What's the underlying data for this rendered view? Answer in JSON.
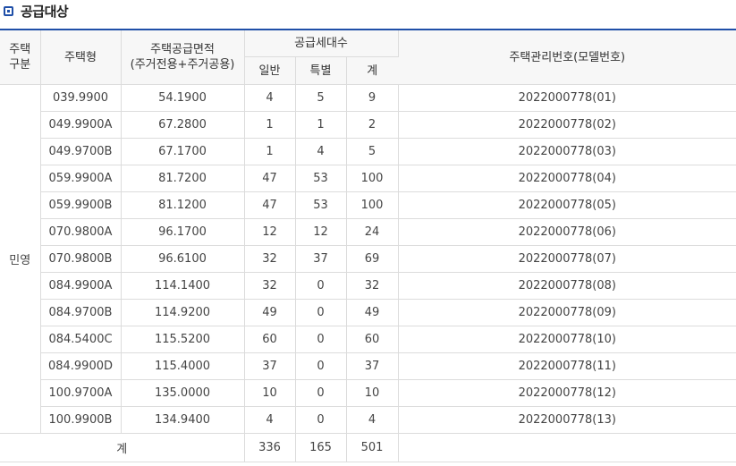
{
  "section_title": "공급대상",
  "header": {
    "col_type_group_line1": "주택",
    "col_type_group_line2": "구분",
    "col_house_type": "주택형",
    "col_area_line1": "주택공급면적",
    "col_area_line2": "(주거전용+주거공용)",
    "col_units": "공급세대수",
    "col_general": "일반",
    "col_special": "특별",
    "col_sum": "계",
    "col_mgmt_no": "주택관리번호(모델번호)"
  },
  "group_label": "민영",
  "rows": [
    {
      "type": "039.9900",
      "area": "54.1900",
      "general": "4",
      "special": "5",
      "sum": "9",
      "mgmt": "2022000778(01)"
    },
    {
      "type": "049.9900A",
      "area": "67.2800",
      "general": "1",
      "special": "1",
      "sum": "2",
      "mgmt": "2022000778(02)"
    },
    {
      "type": "049.9700B",
      "area": "67.1700",
      "general": "1",
      "special": "4",
      "sum": "5",
      "mgmt": "2022000778(03)"
    },
    {
      "type": "059.9900A",
      "area": "81.7200",
      "general": "47",
      "special": "53",
      "sum": "100",
      "mgmt": "2022000778(04)"
    },
    {
      "type": "059.9900B",
      "area": "81.1200",
      "general": "47",
      "special": "53",
      "sum": "100",
      "mgmt": "2022000778(05)"
    },
    {
      "type": "070.9800A",
      "area": "96.1700",
      "general": "12",
      "special": "12",
      "sum": "24",
      "mgmt": "2022000778(06)"
    },
    {
      "type": "070.9800B",
      "area": "96.6100",
      "general": "32",
      "special": "37",
      "sum": "69",
      "mgmt": "2022000778(07)"
    },
    {
      "type": "084.9900A",
      "area": "114.1400",
      "general": "32",
      "special": "0",
      "sum": "32",
      "mgmt": "2022000778(08)"
    },
    {
      "type": "084.9700B",
      "area": "114.9200",
      "general": "49",
      "special": "0",
      "sum": "49",
      "mgmt": "2022000778(09)"
    },
    {
      "type": "084.5400C",
      "area": "115.5200",
      "general": "60",
      "special": "0",
      "sum": "60",
      "mgmt": "2022000778(10)"
    },
    {
      "type": "084.9900D",
      "area": "115.4000",
      "general": "37",
      "special": "0",
      "sum": "37",
      "mgmt": "2022000778(11)"
    },
    {
      "type": "100.9700A",
      "area": "135.0000",
      "general": "10",
      "special": "0",
      "sum": "10",
      "mgmt": "2022000778(12)"
    },
    {
      "type": "100.9900B",
      "area": "134.9400",
      "general": "4",
      "special": "0",
      "sum": "4",
      "mgmt": "2022000778(13)"
    }
  ],
  "total": {
    "label": "계",
    "general": "336",
    "special": "165",
    "sum": "501"
  },
  "colors": {
    "accent": "#1f4fa8",
    "header_bg": "#f7f7f7",
    "border": "#dcdcdc"
  }
}
